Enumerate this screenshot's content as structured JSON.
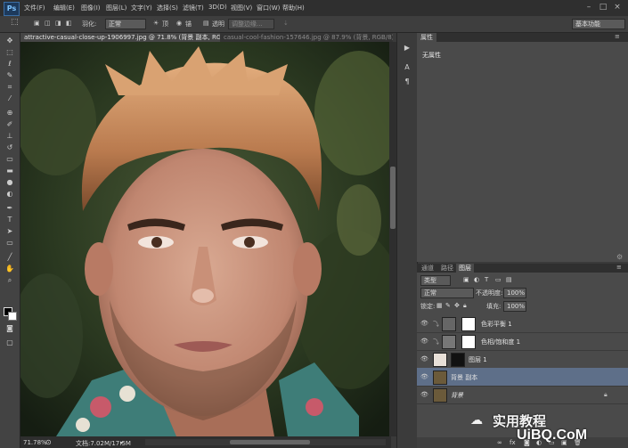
{
  "app": {
    "logo": "Ps"
  },
  "menu": [
    "文件(F)",
    "编辑(E)",
    "图像(I)",
    "图层(L)",
    "文字(Y)",
    "选择(S)",
    "滤镜(T)",
    "3D(D)",
    "视图(V)",
    "窗口(W)",
    "帮助(H)"
  ],
  "options": {
    "feather_label": "羽化:",
    "style_value": "正常",
    "opt1": "顶",
    "opt2": "锚",
    "opt3": "透明",
    "button": "调整边缘...",
    "workspace": "基本功能"
  },
  "tabs": [
    {
      "label": "attractive-casual-close-up-1906997.jpg @ 71.8% (背景 副本, RGB/8) *",
      "close": "×"
    },
    {
      "label": "casual-cool-fashion-157646.jpg @ 87.9% (背景, RGB/8)",
      "close": "×"
    }
  ],
  "status": {
    "zoom": "71.78%",
    "doc": "文档:7.02M/17.5M"
  },
  "properties": {
    "tab": "属性",
    "text": "无属性"
  },
  "layers": {
    "tabs": [
      "通道",
      "路径",
      "图层"
    ],
    "blend_mode": "正常",
    "opacity_label": "不透明度:",
    "opacity_value": "100%",
    "lock_label": "锁定:",
    "fill_label": "填充:",
    "fill_value": "100%",
    "kind": "类型",
    "rows": [
      {
        "name": "色彩平衡 1"
      },
      {
        "name": "色相/饱和度 1"
      },
      {
        "name": "图层 1"
      },
      {
        "name": "背景 副本"
      },
      {
        "name": "背景"
      }
    ]
  },
  "watermark": {
    "brand": "实用教程",
    "site": "UiBQ.CoM"
  },
  "icons": {
    "eye": "eye-icon",
    "lock": "lock-icon"
  },
  "colors": {
    "selected_layer": "#5e6f89",
    "panel": "#4a4a4a"
  }
}
